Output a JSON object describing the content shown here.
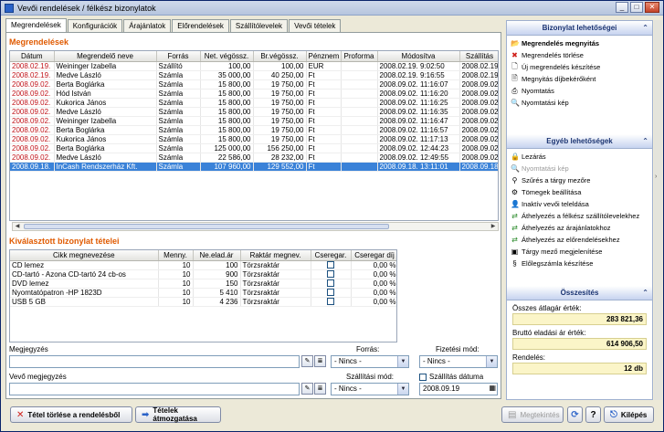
{
  "window": {
    "title": "Vevői rendelések / félkész bizonylatok"
  },
  "tabs": [
    "Megrendelések",
    "Konfigurációk",
    "Árajánlatok",
    "Előrendelések",
    "Szállítólevelek",
    "Vevői tételek"
  ],
  "orders": {
    "title": "Megrendelések",
    "columns": [
      "Dátum",
      "Megrendelő neve",
      "Forrás",
      "Net. végössz.",
      "Br.végössz.",
      "Pénznem",
      "Proforma",
      "Módosítva",
      "Szállítás"
    ],
    "rows": [
      [
        "2008.02.19.",
        "Weininger Izabella",
        "Szállító",
        "100,00",
        "100,00",
        "EUR",
        "",
        "2008.02.19. 9:02:50",
        "2008.02.19"
      ],
      [
        "2008.02.19.",
        "Medve László",
        "Számla",
        "35 000,00",
        "40 250,00",
        "Ft",
        "",
        "2008.02.19. 9:16:55",
        "2008.02.19"
      ],
      [
        "2008.09.02.",
        "Berta Boglárka",
        "Számla",
        "15 800,00",
        "19 750,00",
        "Ft",
        "",
        "2008.09.02. 11:16:07",
        "2008.09.02"
      ],
      [
        "2008.09.02.",
        "Hód István",
        "Számla",
        "15 800,00",
        "19 750,00",
        "Ft",
        "",
        "2008.09.02. 11:16:20",
        "2008.09.02"
      ],
      [
        "2008.09.02.",
        "Kukorica János",
        "Számla",
        "15 800,00",
        "19 750,00",
        "Ft",
        "",
        "2008.09.02. 11:16:25",
        "2008.09.02"
      ],
      [
        "2008.09.02.",
        "Medve László",
        "Számla",
        "15 800,00",
        "19 750,00",
        "Ft",
        "",
        "2008.09.02. 11:16:35",
        "2008.09.02"
      ],
      [
        "2008.09.02.",
        "Weininger Izabella",
        "Számla",
        "15 800,00",
        "19 750,00",
        "Ft",
        "",
        "2008.09.02. 11:16:47",
        "2008.09.02"
      ],
      [
        "2008.09.02.",
        "Berta Boglárka",
        "Számla",
        "15 800,00",
        "19 750,00",
        "Ft",
        "",
        "2008.09.02. 11:16:57",
        "2008.09.02"
      ],
      [
        "2008.09.02.",
        "Kukorica János",
        "Számla",
        "15 800,00",
        "19 750,00",
        "Ft",
        "",
        "2008.09.02. 11:17:13",
        "2008.09.02"
      ],
      [
        "2008.09.02.",
        "Berta Boglárka",
        "Számla",
        "125 000,00",
        "156 250,00",
        "Ft",
        "",
        "2008.09.02. 12:44:23",
        "2008.09.02"
      ],
      [
        "2008.09.02.",
        "Medve László",
        "Számla",
        "22 586,00",
        "28 232,00",
        "Ft",
        "",
        "2008.09.02. 12:49:55",
        "2008.09.02"
      ],
      [
        "2008.09.18.",
        "InCash Rendszerház Kft.",
        "Számla",
        "107 960,00",
        "129 552,00",
        "Ft",
        "",
        "2008.09.18. 13:11:01",
        "2008.09.18"
      ]
    ]
  },
  "items": {
    "title": "Kiválasztott bizonylat tételei",
    "columns": [
      "Cikk megnevezése",
      "Menny.",
      "Ne.elad.ár",
      "Raktár megnev.",
      "Cseregar.",
      "Cseregar díj"
    ],
    "rows": [
      [
        "CD lemez",
        "10",
        "100",
        "Törzsraktár",
        "0,00 %"
      ],
      [
        "CD-tartó - Azona CD-tartó 24 cb-os",
        "10",
        "900",
        "Törzsraktár",
        "0,00 %"
      ],
      [
        "DVD lemez",
        "10",
        "150",
        "Törzsraktár",
        "0,00 %"
      ],
      [
        "Nyomtatópatron -HP 1823D",
        "10",
        "5 410",
        "Törzsraktár",
        "0,00 %"
      ],
      [
        "USB 5 GB",
        "10",
        "4 236",
        "Törzsraktár",
        "0,00 %"
      ]
    ]
  },
  "form": {
    "note_label": "Megjegyzés",
    "customer_note_label": "Vevő megjegyzés",
    "source_label": "Forrás:",
    "source_value": "- Nincs -",
    "payment_label": "Fizetési mód:",
    "payment_value": "- Nincs -",
    "shipping_mode_label": "Szállítási mód:",
    "shipping_mode_value": "- Nincs -",
    "shipping_date_label": "Szállítás dátuma",
    "shipping_date_value": "2008.09.19"
  },
  "buttons": {
    "delete": "Tétel törlése a rendelésből",
    "move": "Tételek átmozgatása",
    "view": "Megtekintés",
    "exit": "Kilépés",
    "help": "?"
  },
  "side": {
    "doc_options_title": "Bizonylat lehetőségei",
    "doc_options": [
      {
        "label": "Megrendelés megnyitás",
        "bold": true,
        "icon": "open-icon"
      },
      {
        "label": "Megrendelés törlése",
        "icon": "delete-icon"
      },
      {
        "label": "Új megrendelés készítése",
        "icon": "new-doc-icon"
      },
      {
        "label": "Megnyitás díjbekérőként",
        "icon": "doc-icon"
      },
      {
        "label": "Nyomtatás",
        "icon": "print-icon"
      },
      {
        "label": "Nyomtatási kép",
        "icon": "preview-icon"
      }
    ],
    "other_options_title": "Egyéb lehetőségek",
    "other_options": [
      {
        "label": "Lezárás",
        "icon": "lock-icon"
      },
      {
        "label": "Nyomtatási kép",
        "disabled": true,
        "icon": "preview-icon"
      },
      {
        "label": "Szűrés a tárgy mezőre",
        "icon": "filter-icon"
      },
      {
        "label": "Tömegek beállítása",
        "icon": "settings-icon"
      },
      {
        "label": "Inaktív vevői teleldása",
        "icon": "user-icon"
      },
      {
        "label": "Áthelyezés a félkész szállítólevelekhez",
        "icon": "move-icon"
      },
      {
        "label": "Áthelyezés az árajánlatokhoz",
        "icon": "move-icon"
      },
      {
        "label": "Áthelyezés az előrendelésekhez",
        "icon": "move-icon"
      },
      {
        "label": "Tárgy mező megjelenítése",
        "icon": "field-icon"
      },
      {
        "label": "Előlegszámla készítése",
        "icon": "invoice-icon"
      }
    ],
    "summary_title": "Összesítés",
    "summary": [
      {
        "label": "Összes átlagár érték:",
        "value": "283 821,36"
      },
      {
        "label": "Bruttó eladási ár érték:",
        "value": "614 906,50"
      },
      {
        "label": "Rendelés:",
        "value": "12 db"
      }
    ]
  }
}
